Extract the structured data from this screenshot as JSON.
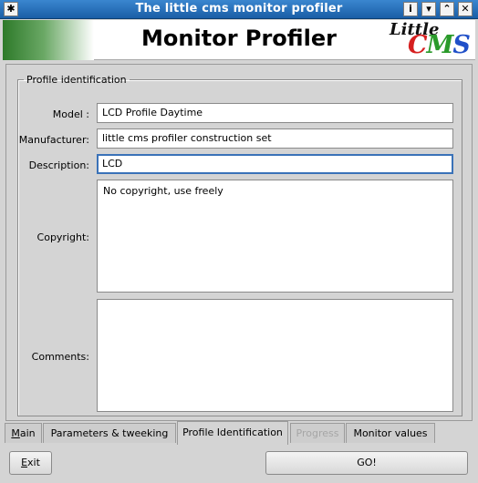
{
  "window": {
    "title": "The little cms monitor profiler",
    "pin_glyph": "✱",
    "buttons": {
      "info": "i",
      "shade": "▾",
      "maximize": "⌃",
      "close": "✕"
    }
  },
  "header": {
    "title": "Monitor Profiler",
    "logo_little": "Little",
    "logo_c": "C",
    "logo_m": "M",
    "logo_s": "S"
  },
  "form": {
    "legend": "Profile identification",
    "model_label": "Model :",
    "model_value": "LCD Profile Daytime",
    "manufacturer_label": "Manufacturer:",
    "manufacturer_value": "little cms profiler construction set",
    "description_label": "Description:",
    "description_value": "LCD",
    "copyright_label": "Copyright:",
    "copyright_value": "No copyright, use freely",
    "comments_label": "Comments:",
    "comments_value": ""
  },
  "tabs": {
    "main_first": "M",
    "main_rest": "ain",
    "parameters": "Parameters & tweeking",
    "profile_identification": "Profile Identification",
    "progress": "Progress",
    "monitor_values": "Monitor values"
  },
  "buttons": {
    "exit_first": "E",
    "exit_rest": "xit",
    "go": "GO!"
  },
  "colors": {
    "titlebar": "#2a74bd",
    "logo_c": "#d62020",
    "logo_m": "#2a9a2a",
    "logo_s": "#2050c8",
    "focus_border": "#3a72b8"
  }
}
